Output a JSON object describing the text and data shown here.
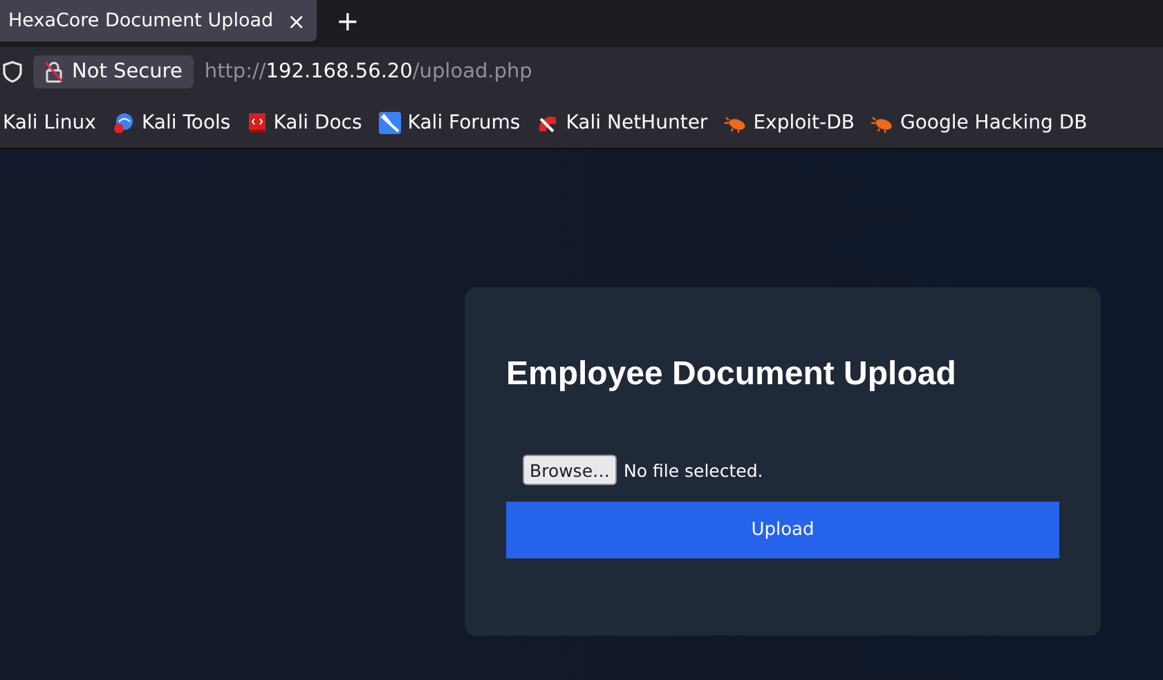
{
  "browser": {
    "tabs": [
      {
        "title": "HexaCore Document Upload",
        "selected": true,
        "close": "×"
      }
    ],
    "new_tab": "+",
    "security": "Not Secure",
    "url": {
      "scheme": "http://",
      "host": "192.168.56.20",
      "path": "/upload.php"
    },
    "bookmarks": [
      {
        "label": "Kali Linux",
        "kind": "none"
      },
      {
        "label": "Kali Tools",
        "kind": "tools"
      },
      {
        "label": "Kali Docs",
        "kind": "docs"
      },
      {
        "label": "Kali Forums",
        "kind": "forums"
      },
      {
        "label": "Kali NetHunter",
        "kind": "nethunter"
      },
      {
        "label": "Exploit-DB",
        "kind": "bug"
      },
      {
        "label": "Google Hacking DB",
        "kind": "bug"
      }
    ]
  },
  "page": {
    "title": "Employee Document Upload",
    "file_input": {
      "button": "Browse…",
      "status": "No file selected."
    },
    "submit": "Upload"
  }
}
